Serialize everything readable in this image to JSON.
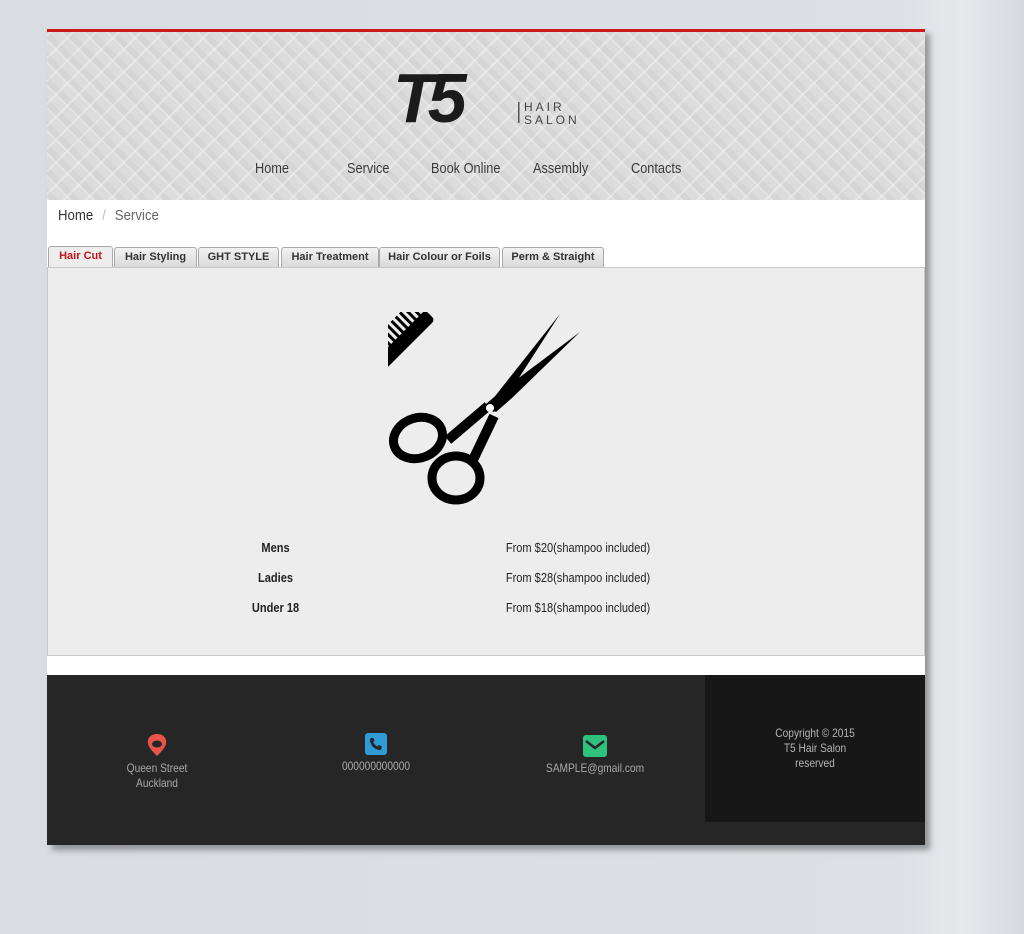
{
  "brand": {
    "logo_text": "T5",
    "tagline_line1": "HAIR",
    "tagline_line2": "SALON",
    "accent": "#cc1a1a"
  },
  "nav": {
    "items": [
      {
        "label": "Home"
      },
      {
        "label": "Service"
      },
      {
        "label": "Book Online"
      },
      {
        "label": "Assembly"
      },
      {
        "label": "Contacts"
      }
    ]
  },
  "breadcrumb": {
    "home": "Home",
    "separator": "/",
    "current": "Service"
  },
  "tabs": [
    {
      "label": "Hair Cut",
      "active": true
    },
    {
      "label": "Hair Styling"
    },
    {
      "label": "GHT STYLE"
    },
    {
      "label": "Hair Treatment"
    },
    {
      "label": "Hair Colour or Foils"
    },
    {
      "label": "Perm & Straight"
    }
  ],
  "panel": {
    "icon": "scissors-comb-icon",
    "prices": [
      {
        "name": "Mens",
        "value": "From $20(shampoo included)"
      },
      {
        "name": "Ladies",
        "value": "From $28(shampoo included)"
      },
      {
        "name": "Under 18",
        "value": "From $18(shampoo included)"
      }
    ]
  },
  "footer": {
    "address": {
      "icon": "map-pin-icon",
      "line1": "Queen Street",
      "line2": "Auckland",
      "color": "#e8544a"
    },
    "phone": {
      "icon": "phone-icon",
      "text": "000000000000",
      "color": "#2f9ad6"
    },
    "email": {
      "icon": "envelope-icon",
      "text": "SAMPLE@gmail.com",
      "color": "#2ec27e"
    },
    "copyright": {
      "line1": "Copyright © 2015",
      "line2": "T5 Hair Salon",
      "line3": "reserved"
    }
  }
}
